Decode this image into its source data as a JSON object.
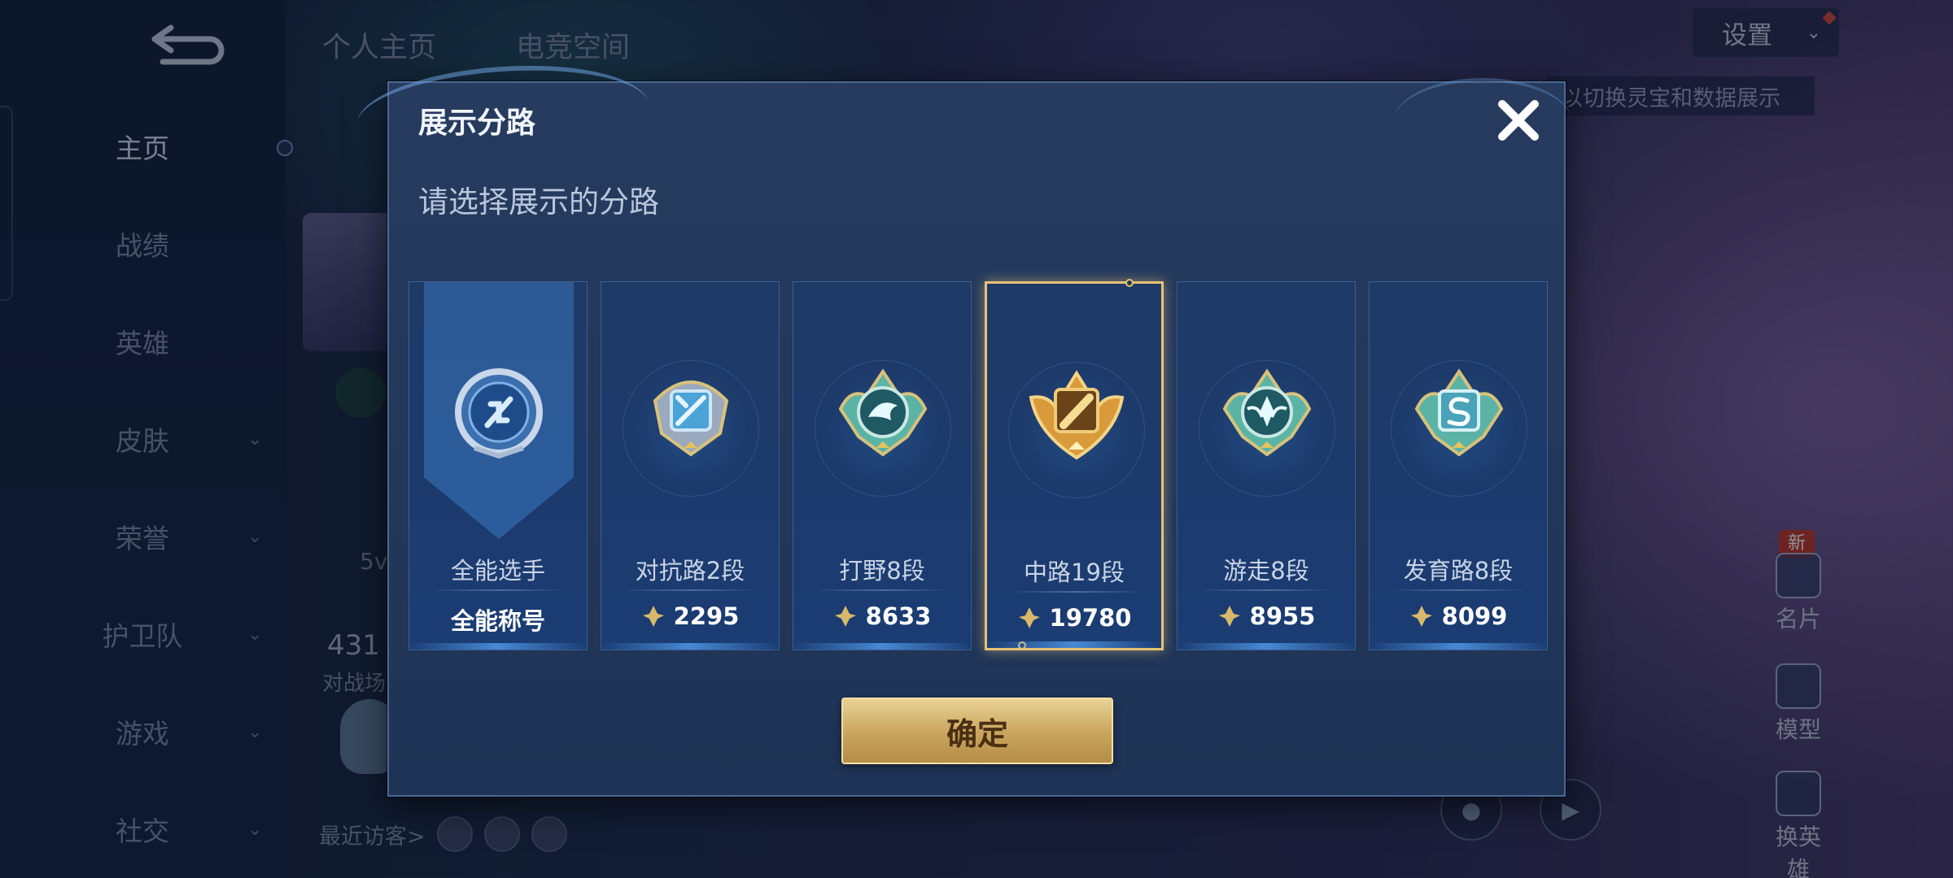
{
  "sidebar": {
    "items": [
      {
        "label": "主页",
        "active": true
      },
      {
        "label": "战绩",
        "active": false
      },
      {
        "label": "英雄",
        "active": false
      },
      {
        "label": "皮肤",
        "active": false,
        "expandable": true
      },
      {
        "label": "荣誉",
        "active": false,
        "expandable": true
      },
      {
        "label": "护卫队",
        "active": false,
        "expandable": true
      },
      {
        "label": "游戏",
        "active": false,
        "expandable": true
      },
      {
        "label": "社交",
        "active": false,
        "expandable": true
      }
    ]
  },
  "top_tabs": [
    "个人主页",
    "电竞空间"
  ],
  "settings": {
    "label": "设置"
  },
  "hint": "以切换灵宝和数据展示",
  "background_profile": {
    "stat_partial": "5v",
    "number_partial": "431",
    "number_sub_partial": "对战场",
    "recent_visitors": "最近访客>"
  },
  "right_buttons": [
    {
      "label": "名片",
      "icon": "card-icon",
      "new_badge": "新"
    },
    {
      "label": "模型",
      "icon": "model-icon"
    },
    {
      "label": "换英雄",
      "icon": "swap-hero-icon"
    }
  ],
  "dialog": {
    "title": "展示分路",
    "subtitle": "请选择展示的分路",
    "confirm_label": "确定",
    "cards": [
      {
        "label": "全能选手",
        "value": "全能称号",
        "selected": false,
        "medal": "all-round-medal-icon",
        "has_coin": false
      },
      {
        "label": "对抗路2段",
        "value": "2295",
        "selected": false,
        "medal": "clash-lane-medal-icon",
        "has_coin": true
      },
      {
        "label": "打野8段",
        "value": "8633",
        "selected": false,
        "medal": "jungle-medal-icon",
        "has_coin": true
      },
      {
        "label": "中路19段",
        "value": "19780",
        "selected": true,
        "medal": "mid-lane-medal-icon",
        "has_coin": true
      },
      {
        "label": "游走8段",
        "value": "8955",
        "selected": false,
        "medal": "roam-medal-icon",
        "has_coin": true
      },
      {
        "label": "发育路8段",
        "value": "8099",
        "selected": false,
        "medal": "farm-lane-medal-icon",
        "has_coin": true
      }
    ]
  },
  "colors": {
    "selected_border": "#e7c274",
    "confirm_gold": "#c9a45c",
    "dialog_bg": "#23385b"
  }
}
